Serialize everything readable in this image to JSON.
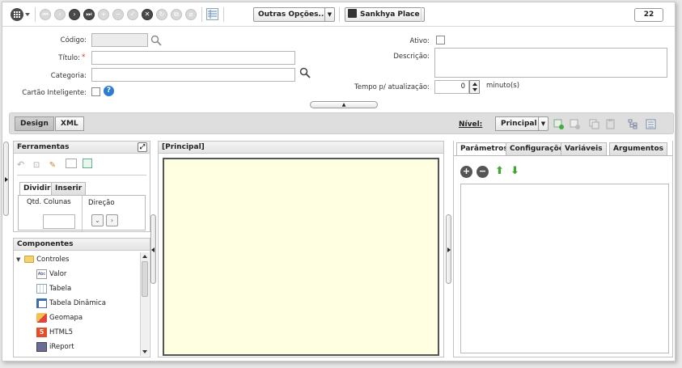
{
  "toolbar": {
    "outras_opcoes": "Outras Opções...",
    "sankhya_place": "Sankhya Place",
    "counter": "22"
  },
  "form": {
    "codigo_label": "Código:",
    "titulo_label": "Título:",
    "required_mark": "*",
    "categoria_label": "Categoria:",
    "cartao_label": "Cartão Inteligente:",
    "ativo_label": "Ativo:",
    "descricao_label": "Descrição:",
    "tempo_label": "Tempo p/ atualização:",
    "tempo_value": "0",
    "tempo_unit": "minuto(s)"
  },
  "design_bar": {
    "design_tab": "Design",
    "xml_tab": "XML",
    "nivel_label": "Nível:",
    "nivel_value": "Principal"
  },
  "ferramentas": {
    "title": "Ferramentas",
    "tab_dividir": "Dividir",
    "tab_inserir": "Inserir",
    "qtd_colunas": "Qtd. Colunas",
    "direcao": "Direção"
  },
  "componentes": {
    "title": "Componentes",
    "root": "Controles",
    "items": [
      "Valor",
      "Tabela",
      "Tabela Dinâmica",
      "Geomapa",
      "HTML5",
      "iReport"
    ],
    "valor_icon_text": "Abc"
  },
  "principal": {
    "title": "[Principal]"
  },
  "right_panel": {
    "tabs": [
      "Parâmetros",
      "Configurações",
      "Variáveis",
      "Argumentos"
    ]
  }
}
